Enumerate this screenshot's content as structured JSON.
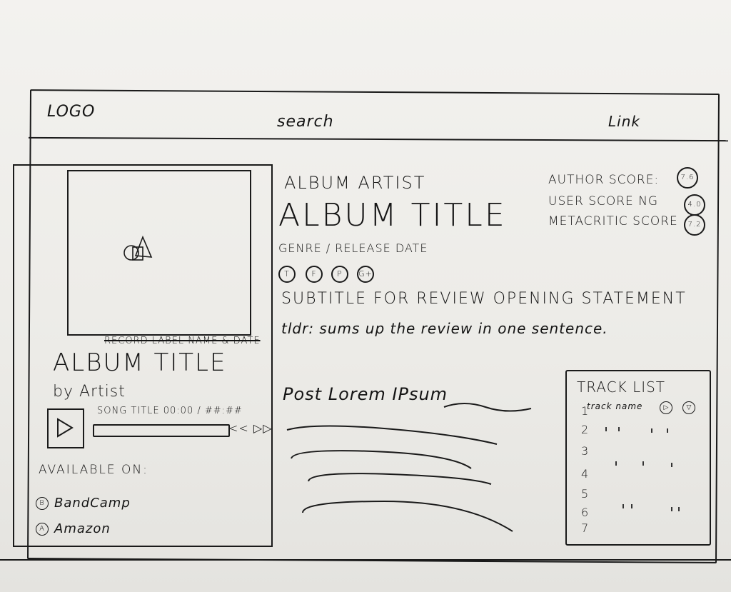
{
  "header": {
    "logo": "LOGO",
    "search": "search",
    "link": "Link"
  },
  "left_panel": {
    "cover_icon": "album-art-placeholder-icon",
    "record_label": "RECORD LABEL NAME & DATE",
    "album_title": "ALBUM TITLE",
    "by_artist": "by Artist",
    "player": {
      "song_info": "SONG TITLE 00:00 / ##:##",
      "transport": "<< ▷▷"
    },
    "available_on": "AVAILABLE ON:",
    "stores": [
      {
        "icon": "B",
        "name": "BandCamp"
      },
      {
        "icon": "A",
        "name": "Amazon"
      }
    ]
  },
  "main": {
    "album_artist": "ALBUM ARTIST",
    "album_title": "ALBUM TITLE",
    "genre_date": "GENRE / RELEASE DATE",
    "share_icons": [
      "T",
      "F",
      "P",
      "G+"
    ],
    "subtitle": "SUBTITLE FOR REVIEW OPENING STATEMENT",
    "tldr": "tldr: sums up the review in one sentence.",
    "post": "Post Lorem IPsum"
  },
  "scores": [
    {
      "label": "AUTHOR SCORE:",
      "value": "7.6"
    },
    {
      "label": "USER SCORE NG",
      "value": "4.0"
    },
    {
      "label": "METACRITIC SCORE",
      "value": "7.2"
    }
  ],
  "tracklist": {
    "title": "TRACK LIST",
    "first_track": "track name",
    "numbers": [
      "1",
      "2",
      "3",
      "4",
      "5",
      "6",
      "7"
    ]
  }
}
